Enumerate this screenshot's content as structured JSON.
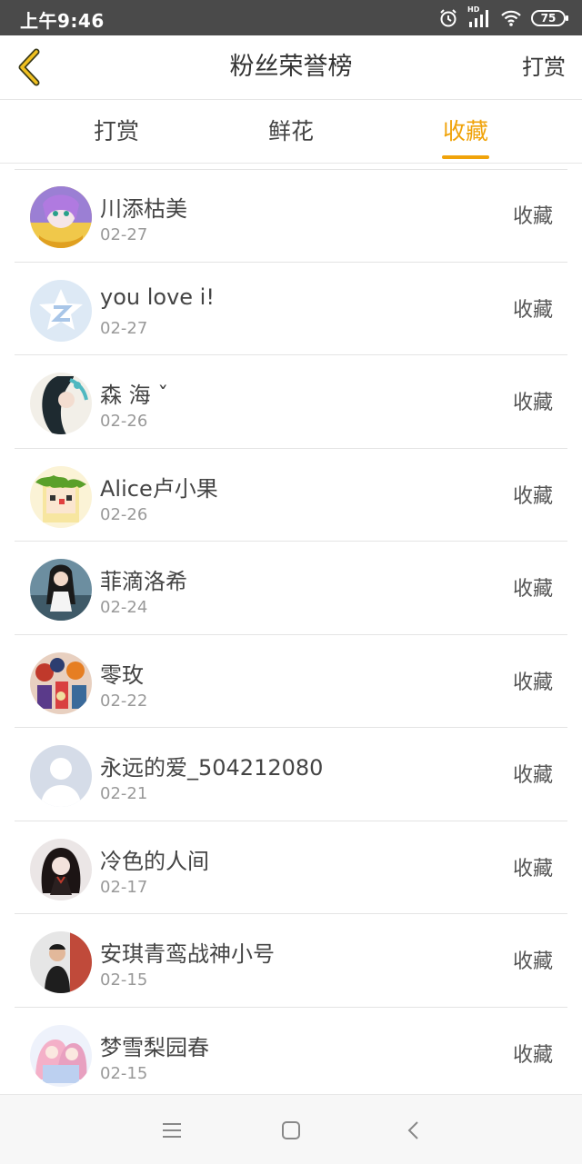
{
  "status_bar": {
    "time": "上午9:46",
    "network_label": "HD",
    "battery": "75"
  },
  "header": {
    "title": "粉丝荣誉榜",
    "action": "打赏"
  },
  "tabs": [
    {
      "label": "打赏",
      "active": false
    },
    {
      "label": "鲜花",
      "active": false
    },
    {
      "label": "收藏",
      "active": true
    }
  ],
  "colors": {
    "accent": "#f0a30a",
    "status_bar": "#4a4a4a",
    "divider": "#e4e4e4"
  },
  "fans": [
    {
      "name": "川添枯美",
      "date": "02-27",
      "action": "收藏",
      "avatar": "anime-girl-purple"
    },
    {
      "name": "you love i!",
      "date": "02-27",
      "action": "收藏",
      "avatar": "default-qzone-star"
    },
    {
      "name": "森 海 ˇ",
      "date": "02-26",
      "action": "收藏",
      "avatar": "anime-girl-teal"
    },
    {
      "name": "Alice卢小果",
      "date": "02-26",
      "action": "收藏",
      "avatar": "pixel-girl-leaf-crown"
    },
    {
      "name": "菲滴洛希",
      "date": "02-24",
      "action": "收藏",
      "avatar": "girl-photo"
    },
    {
      "name": "零玫",
      "date": "02-22",
      "action": "收藏",
      "avatar": "colorful-illustration"
    },
    {
      "name": "永远的爱_504212080",
      "date": "02-21",
      "action": "收藏",
      "avatar": "default-silhouette"
    },
    {
      "name": "冷色的人间",
      "date": "02-17",
      "action": "收藏",
      "avatar": "dark-hair-girl"
    },
    {
      "name": "安琪青鸾战神小号",
      "date": "02-15",
      "action": "收藏",
      "avatar": "boy-photo"
    },
    {
      "name": "梦雪梨园春",
      "date": "02-15",
      "action": "收藏",
      "avatar": "anime-pastel-girls"
    }
  ],
  "bottom_nav": {
    "menu_icon": "menu-icon",
    "home_icon": "home-square-icon",
    "back_icon": "back-chevron-icon"
  }
}
